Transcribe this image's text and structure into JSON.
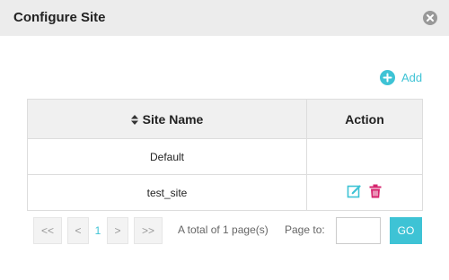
{
  "dialog": {
    "title": "Configure Site"
  },
  "toolbar": {
    "add_label": "Add"
  },
  "table": {
    "columns": [
      "Site Name",
      "Action"
    ],
    "rows": [
      {
        "name": "Default",
        "actions": []
      },
      {
        "name": "test_site",
        "actions": [
          "edit",
          "delete"
        ]
      }
    ]
  },
  "pagination": {
    "first": "<<",
    "prev": "<",
    "current_page": "1",
    "next": ">",
    "last": ">>",
    "total_text": "A total of 1 page(s)",
    "page_to_label": "Page to:",
    "page_input_value": "",
    "go_label": "GO"
  },
  "colors": {
    "accent": "#3ec3d5",
    "delete": "#d6246e",
    "header_bg": "#ececec"
  },
  "icons": {
    "close": "close-circle-icon",
    "add": "plus-circle-icon",
    "sort": "sort-icon",
    "edit": "edit-icon",
    "delete": "trash-icon"
  }
}
